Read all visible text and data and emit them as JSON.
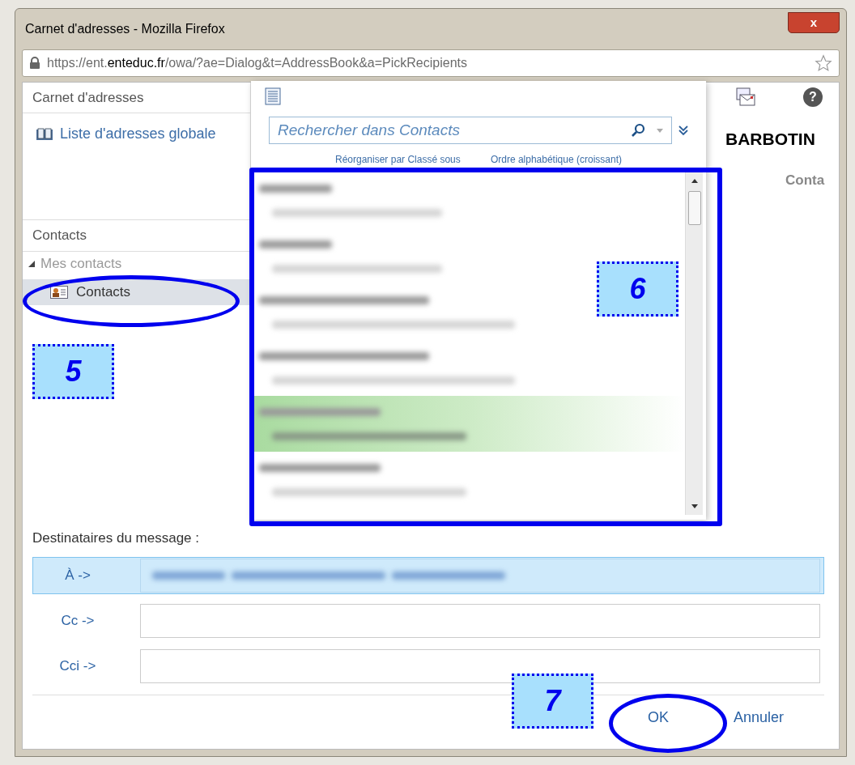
{
  "window": {
    "title": "Carnet d'adresses - Mozilla Firefox",
    "close": "x"
  },
  "address_bar": {
    "url_prefix": "https://ent.",
    "url_domain": "enteduc.fr",
    "url_rest": "/owa/?ae=Dialog&t=AddressBook&a=PickRecipients"
  },
  "left_pane": {
    "header": "Carnet d'adresses",
    "global_list": "Liste d'adresses globale",
    "contacts_header": "Contacts",
    "tree": [
      {
        "label": "Mes contacts",
        "expanded": true,
        "children": [
          {
            "label": "Contacts",
            "selected": true
          }
        ]
      }
    ]
  },
  "search": {
    "placeholder": "Rechercher dans Contacts"
  },
  "sort": {
    "arrange_by": "Réorganiser par Classé sous",
    "order": "Ordre alphabétique (croissant)"
  },
  "contacts": [
    {
      "selected": false
    },
    {
      "selected": false
    },
    {
      "selected": false
    },
    {
      "selected": false
    },
    {
      "selected": true
    },
    {
      "selected": false
    }
  ],
  "right_pane": {
    "help": "?",
    "name": "BARBOTIN",
    "section": "Conta"
  },
  "recipients": {
    "label": "Destinataires du message :",
    "rows": [
      {
        "label": "À ->",
        "selected": true,
        "filled": true
      },
      {
        "label": "Cc ->",
        "selected": false,
        "filled": false
      },
      {
        "label": "Cci ->",
        "selected": false,
        "filled": false
      }
    ]
  },
  "buttons": [
    {
      "label": "OK"
    },
    {
      "label": "Annuler"
    }
  ],
  "callouts": [
    {
      "label": "5"
    },
    {
      "label": "6"
    },
    {
      "label": "7"
    }
  ]
}
